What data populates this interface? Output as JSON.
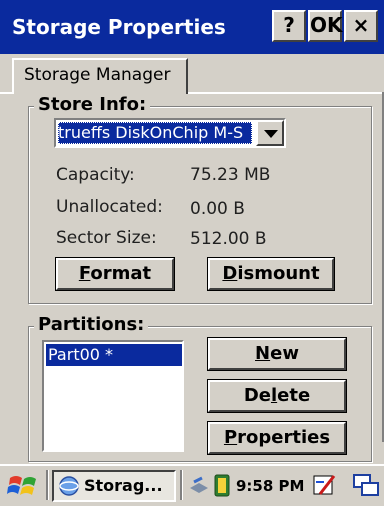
{
  "window": {
    "title": "Storage Properties",
    "help_label": "?",
    "ok_label": "OK",
    "close_label": "×"
  },
  "tabs": [
    {
      "label": "Storage Manager"
    }
  ],
  "store_info": {
    "legend": "Store Info:",
    "store_selected": "trueffs DiskOnChip M-S",
    "capacity_label": "Capacity:",
    "capacity_value": "75.23 MB",
    "unallocated_label": "Unallocated:",
    "unallocated_value": "0.00 B",
    "sector_label": "Sector Size:",
    "sector_value": "512.00 B",
    "format_first": "F",
    "format_rest": "ormat",
    "dismount_first": "D",
    "dismount_rest": "ismount"
  },
  "partitions": {
    "legend": "Partitions:",
    "items": [
      "Part00 *"
    ],
    "new_first": "N",
    "new_rest": "ew",
    "delete_pre": "De",
    "delete_ul": "l",
    "delete_post": "ete",
    "properties_first": "P",
    "properties_rest": "roperties"
  },
  "taskbar": {
    "task_label": "Storag...",
    "clock": "9:58 PM",
    "icons": [
      "start-flag-icon",
      "app-globe-icon",
      "network-icon",
      "battery-icon",
      "input-panel-icon",
      "desktop-icon"
    ]
  },
  "colors": {
    "titlebar": "#0a2a9e",
    "selection": "#0a2a9e",
    "face": "#d4d0c8"
  }
}
